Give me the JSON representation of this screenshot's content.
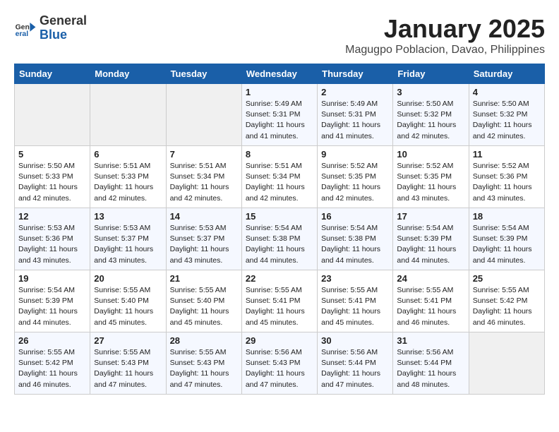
{
  "header": {
    "logo_general": "General",
    "logo_blue": "Blue",
    "month": "January 2025",
    "location": "Magugpo Poblacion, Davao, Philippines"
  },
  "weekdays": [
    "Sunday",
    "Monday",
    "Tuesday",
    "Wednesday",
    "Thursday",
    "Friday",
    "Saturday"
  ],
  "weeks": [
    [
      {
        "day": "",
        "info": ""
      },
      {
        "day": "",
        "info": ""
      },
      {
        "day": "",
        "info": ""
      },
      {
        "day": "1",
        "info": "Sunrise: 5:49 AM\nSunset: 5:31 PM\nDaylight: 11 hours\nand 41 minutes."
      },
      {
        "day": "2",
        "info": "Sunrise: 5:49 AM\nSunset: 5:31 PM\nDaylight: 11 hours\nand 41 minutes."
      },
      {
        "day": "3",
        "info": "Sunrise: 5:50 AM\nSunset: 5:32 PM\nDaylight: 11 hours\nand 42 minutes."
      },
      {
        "day": "4",
        "info": "Sunrise: 5:50 AM\nSunset: 5:32 PM\nDaylight: 11 hours\nand 42 minutes."
      }
    ],
    [
      {
        "day": "5",
        "info": "Sunrise: 5:50 AM\nSunset: 5:33 PM\nDaylight: 11 hours\nand 42 minutes."
      },
      {
        "day": "6",
        "info": "Sunrise: 5:51 AM\nSunset: 5:33 PM\nDaylight: 11 hours\nand 42 minutes."
      },
      {
        "day": "7",
        "info": "Sunrise: 5:51 AM\nSunset: 5:34 PM\nDaylight: 11 hours\nand 42 minutes."
      },
      {
        "day": "8",
        "info": "Sunrise: 5:51 AM\nSunset: 5:34 PM\nDaylight: 11 hours\nand 42 minutes."
      },
      {
        "day": "9",
        "info": "Sunrise: 5:52 AM\nSunset: 5:35 PM\nDaylight: 11 hours\nand 42 minutes."
      },
      {
        "day": "10",
        "info": "Sunrise: 5:52 AM\nSunset: 5:35 PM\nDaylight: 11 hours\nand 43 minutes."
      },
      {
        "day": "11",
        "info": "Sunrise: 5:52 AM\nSunset: 5:36 PM\nDaylight: 11 hours\nand 43 minutes."
      }
    ],
    [
      {
        "day": "12",
        "info": "Sunrise: 5:53 AM\nSunset: 5:36 PM\nDaylight: 11 hours\nand 43 minutes."
      },
      {
        "day": "13",
        "info": "Sunrise: 5:53 AM\nSunset: 5:37 PM\nDaylight: 11 hours\nand 43 minutes."
      },
      {
        "day": "14",
        "info": "Sunrise: 5:53 AM\nSunset: 5:37 PM\nDaylight: 11 hours\nand 43 minutes."
      },
      {
        "day": "15",
        "info": "Sunrise: 5:54 AM\nSunset: 5:38 PM\nDaylight: 11 hours\nand 44 minutes."
      },
      {
        "day": "16",
        "info": "Sunrise: 5:54 AM\nSunset: 5:38 PM\nDaylight: 11 hours\nand 44 minutes."
      },
      {
        "day": "17",
        "info": "Sunrise: 5:54 AM\nSunset: 5:39 PM\nDaylight: 11 hours\nand 44 minutes."
      },
      {
        "day": "18",
        "info": "Sunrise: 5:54 AM\nSunset: 5:39 PM\nDaylight: 11 hours\nand 44 minutes."
      }
    ],
    [
      {
        "day": "19",
        "info": "Sunrise: 5:54 AM\nSunset: 5:39 PM\nDaylight: 11 hours\nand 44 minutes."
      },
      {
        "day": "20",
        "info": "Sunrise: 5:55 AM\nSunset: 5:40 PM\nDaylight: 11 hours\nand 45 minutes."
      },
      {
        "day": "21",
        "info": "Sunrise: 5:55 AM\nSunset: 5:40 PM\nDaylight: 11 hours\nand 45 minutes."
      },
      {
        "day": "22",
        "info": "Sunrise: 5:55 AM\nSunset: 5:41 PM\nDaylight: 11 hours\nand 45 minutes."
      },
      {
        "day": "23",
        "info": "Sunrise: 5:55 AM\nSunset: 5:41 PM\nDaylight: 11 hours\nand 45 minutes."
      },
      {
        "day": "24",
        "info": "Sunrise: 5:55 AM\nSunset: 5:41 PM\nDaylight: 11 hours\nand 46 minutes."
      },
      {
        "day": "25",
        "info": "Sunrise: 5:55 AM\nSunset: 5:42 PM\nDaylight: 11 hours\nand 46 minutes."
      }
    ],
    [
      {
        "day": "26",
        "info": "Sunrise: 5:55 AM\nSunset: 5:42 PM\nDaylight: 11 hours\nand 46 minutes."
      },
      {
        "day": "27",
        "info": "Sunrise: 5:55 AM\nSunset: 5:43 PM\nDaylight: 11 hours\nand 47 minutes."
      },
      {
        "day": "28",
        "info": "Sunrise: 5:55 AM\nSunset: 5:43 PM\nDaylight: 11 hours\nand 47 minutes."
      },
      {
        "day": "29",
        "info": "Sunrise: 5:56 AM\nSunset: 5:43 PM\nDaylight: 11 hours\nand 47 minutes."
      },
      {
        "day": "30",
        "info": "Sunrise: 5:56 AM\nSunset: 5:44 PM\nDaylight: 11 hours\nand 47 minutes."
      },
      {
        "day": "31",
        "info": "Sunrise: 5:56 AM\nSunset: 5:44 PM\nDaylight: 11 hours\nand 48 minutes."
      },
      {
        "day": "",
        "info": ""
      }
    ]
  ]
}
